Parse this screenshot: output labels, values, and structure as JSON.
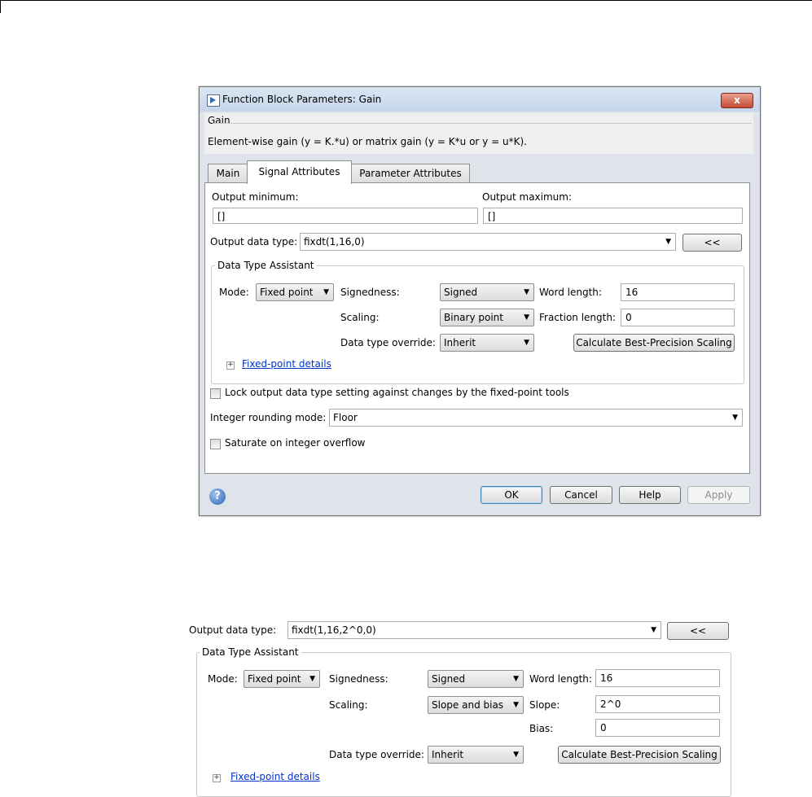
{
  "dialog": {
    "title": "Function Block Parameters: Gain",
    "close_label": "x",
    "group_label": "Gain",
    "description": "Element-wise gain (y = K.*u) or matrix gain (y = K*u or y = u*K).",
    "tabs": [
      {
        "label": "Main",
        "active": false
      },
      {
        "label": "Signal Attributes",
        "active": true
      },
      {
        "label": "Parameter Attributes",
        "active": false
      }
    ],
    "output_min_label": "Output minimum:",
    "output_min_value": "[]",
    "output_max_label": "Output maximum:",
    "output_max_value": "[]",
    "output_dtype_label": "Output data type:",
    "output_dtype_value": "fixdt(1,16,0)",
    "dta_button": "<<",
    "dta_title": "Data Type Assistant",
    "mode_label": "Mode:",
    "mode_value": "Fixed point",
    "signedness_label": "Signedness:",
    "signedness_value": "Signed",
    "word_length_label": "Word length:",
    "word_length_value": "16",
    "scaling_label": "Scaling:",
    "scaling_value": "Binary point",
    "fraction_length_label": "Fraction length:",
    "fraction_length_value": "0",
    "override_label": "Data type override:",
    "override_value": "Inherit",
    "calc_button": "Calculate Best-Precision Scaling",
    "details_link": "Fixed-point details",
    "lock_label": "Lock output data type setting against changes by the fixed-point tools",
    "rounding_label": "Integer rounding mode:",
    "rounding_value": "Floor",
    "saturate_label": "Saturate on integer overflow",
    "help_icon": "?",
    "ok": "OK",
    "cancel": "Cancel",
    "help": "Help",
    "apply": "Apply"
  },
  "lower": {
    "output_dtype_label": "Output data type:",
    "output_dtype_value": "fixdt(1,16,2^0,0)",
    "dta_button": "<<",
    "dta_title": "Data Type Assistant",
    "mode_label": "Mode:",
    "mode_value": "Fixed point",
    "signedness_label": "Signedness:",
    "signedness_value": "Signed",
    "word_length_label": "Word length:",
    "word_length_value": "16",
    "scaling_label": "Scaling:",
    "scaling_value": "Slope and bias",
    "slope_label": "Slope:",
    "slope_value": "2^0",
    "bias_label": "Bias:",
    "bias_value": "0",
    "override_label": "Data type override:",
    "override_value": "Inherit",
    "calc_button": "Calculate Best-Precision Scaling",
    "details_link": "Fixed-point details"
  }
}
